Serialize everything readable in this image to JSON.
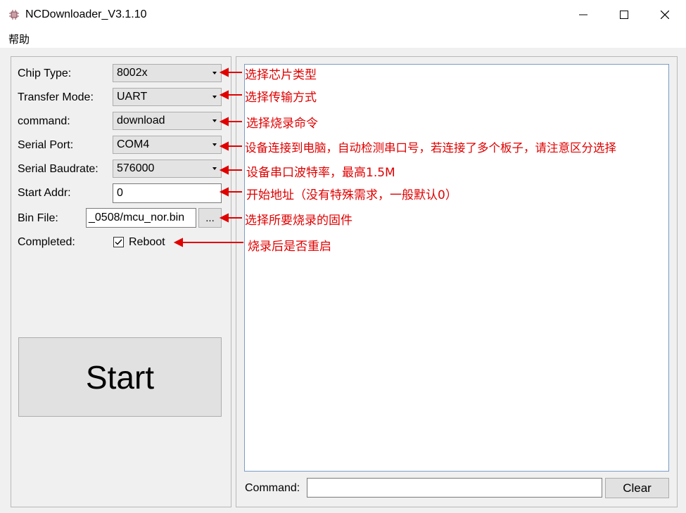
{
  "window": {
    "title": "NCDownloader_V3.1.10",
    "controls": {
      "minimize": "—",
      "maximize": "☐",
      "close": "✕"
    }
  },
  "menu": {
    "help": "帮助"
  },
  "form": {
    "chip_type": {
      "label": "Chip Type:",
      "value": "8002x"
    },
    "transfer_mode": {
      "label": "Transfer Mode:",
      "value": "UART"
    },
    "command": {
      "label": "command:",
      "value": "download"
    },
    "serial_port": {
      "label": "Serial Port:",
      "value": "COM4"
    },
    "serial_baudrate": {
      "label": "Serial Baudrate:",
      "value": "576000"
    },
    "start_addr": {
      "label": "Start Addr:",
      "value": "0"
    },
    "bin_file": {
      "label": "Bin File:",
      "value": "_0508/mcu_nor.bin",
      "browse_label": "..."
    },
    "completed": {
      "label": "Completed:",
      "reboot_label": "Reboot",
      "reboot_checked": true
    },
    "start_button": "Start"
  },
  "log": {
    "command_label": "Command:",
    "command_value": "",
    "clear_button": "Clear"
  },
  "annotations": [
    "选择芯片类型",
    "选择传输方式",
    "选择烧录命令",
    "设备连接到电脑，自动检测串口号，若连接了多个板子，请注意区分选择",
    "设备串口波特率，最高1.5M",
    "开始地址（没有特殊需求，一般默认0）",
    "选择所要烧录的固件",
    "烧录后是否重启"
  ],
  "colors": {
    "annotation": "#e00000",
    "panel_border": "#b8b8b8"
  }
}
